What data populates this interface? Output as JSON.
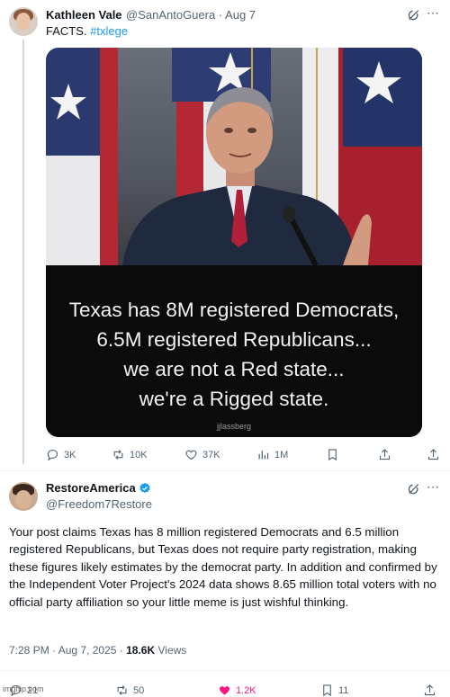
{
  "tweet1": {
    "author_name": "Kathleen Vale",
    "author_handle": "@SanAntoGuera",
    "sep": " · ",
    "date": "Aug 7",
    "text": "FACTS.",
    "hashtag": "#txlege",
    "image": {
      "caption_lines": [
        "Texas has 8M registered Democrats,",
        "6.5M registered Republicans...",
        "we are not a Red state...",
        "we're a Rigged state."
      ],
      "credit": "jjlassberg"
    },
    "actions": {
      "replies": "3K",
      "reposts": "10K",
      "likes": "37K",
      "views": "1M"
    }
  },
  "tweet2": {
    "author_name": "RestoreAmerica",
    "author_handle": "@Freedom7Restore",
    "text": "Your post claims Texas has 8 million registered Democrats and 6.5 million registered Republicans, but Texas does not require party registration, making these figures likely estimates by the democrat party. In addition and confirmed by the Independent Voter Project's 2024 data shows 8.65 million total voters with no official party affiliation so your little meme is just wishful thinking.",
    "time": "7:28 PM",
    "dot": " · ",
    "date": "Aug 7, 2025",
    "views_count": "18.6K",
    "views_label": " Views",
    "actions": {
      "replies": "21",
      "reposts": "50",
      "likes": "1.2K",
      "bookmarks": "11"
    }
  },
  "watermark": "imgflip.com",
  "colors": {
    "accent": "#1d9bf0",
    "like_active": "#f91880",
    "muted": "#536471"
  }
}
